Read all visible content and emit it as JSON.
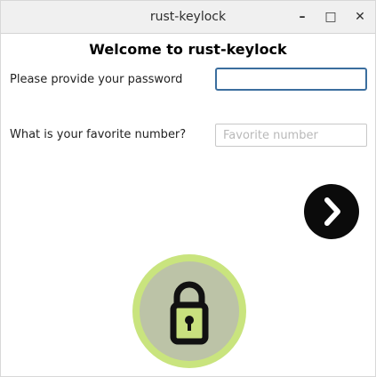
{
  "window": {
    "title": "rust-keylock",
    "controls": {
      "minimize": "–",
      "maximize": "□",
      "close": "✕"
    }
  },
  "main": {
    "heading": "Welcome to rust-keylock",
    "password": {
      "label": "Please provide your password",
      "value": "",
      "placeholder": ""
    },
    "favorite": {
      "label": "What is your favorite number?",
      "value": "",
      "placeholder": "Favorite number"
    },
    "next_icon": "chevron-right-icon",
    "lock_icon": "padlock-icon"
  },
  "colors": {
    "accent_focus": "#3b6e9e",
    "lock_ring": "#c9e47e",
    "lock_body": "#c8e07e",
    "next_button": "#0b0b0b"
  }
}
